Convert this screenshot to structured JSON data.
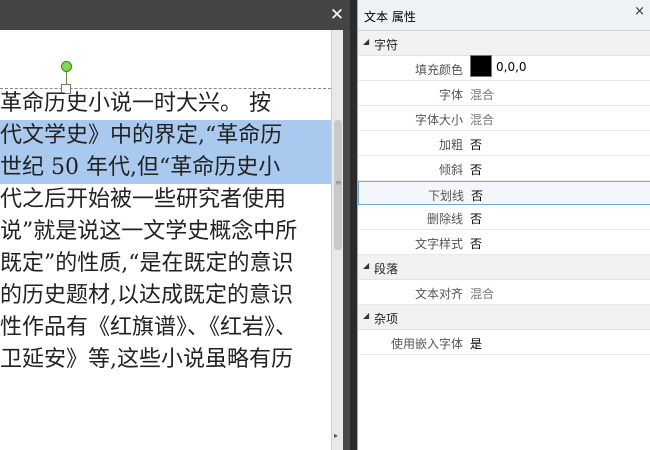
{
  "editor": {
    "lines": [
      {
        "text": "革命历史小说一时大兴。 按",
        "highlight": false
      },
      {
        "text": "代文学史》中的界定,“革命历",
        "highlight": true
      },
      {
        "text": "世纪 50 年代,但“革命历史小",
        "highlight": true
      },
      {
        "text": "代之后开始被一些研究者使用",
        "highlight": false
      },
      {
        "text": "说”就是说这一文学史概念中所",
        "highlight": false
      },
      {
        "text": "既定”的性质,“是在既定的意识",
        "highlight": false
      },
      {
        "text": "的历史题材,以达成既定的意识",
        "highlight": false
      },
      {
        "text": "性作品有《红旗谱》、《红岩》、",
        "highlight": false
      },
      {
        "text": "卫延安》等,这些小说虽略有历",
        "highlight": false
      }
    ]
  },
  "panel": {
    "title": "文本 属性",
    "sections": [
      {
        "name": "字符",
        "rows": [
          {
            "label": "填充颜色",
            "value": "0,0,0",
            "swatch": "#000000",
            "muted": false
          },
          {
            "label": "字体",
            "value": "混合",
            "muted": true
          },
          {
            "label": "字体大小",
            "value": "混合",
            "muted": true
          },
          {
            "label": "加粗",
            "value": "否",
            "muted": false
          },
          {
            "label": "倾斜",
            "value": "否",
            "muted": false
          },
          {
            "label": "下划线",
            "value": "否",
            "muted": false,
            "active": true
          },
          {
            "label": "删除线",
            "value": "否",
            "muted": false
          },
          {
            "label": "文字样式",
            "value": "否",
            "muted": false
          }
        ]
      },
      {
        "name": "段落",
        "rows": [
          {
            "label": "文本对齐",
            "value": "混合",
            "muted": true
          }
        ]
      },
      {
        "name": "杂项",
        "rows": [
          {
            "label": "使用嵌入字体",
            "value": "是",
            "muted": false
          }
        ]
      }
    ]
  }
}
